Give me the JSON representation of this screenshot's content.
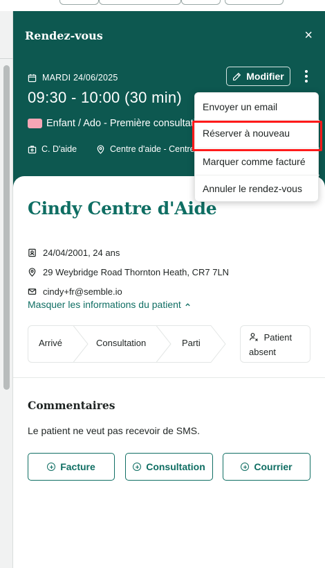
{
  "panel": {
    "title": "Rendez-vous",
    "close_label": "×"
  },
  "appointment": {
    "date": "MARDI 24/06/2025",
    "time": "09:30 - 10:00  (30 min)",
    "type": "Enfant / Ado - Première consultation",
    "type_color": "#f5a6b6",
    "practitioner": "C. D'aide",
    "location": "Centre d'aide - Centre"
  },
  "actions": {
    "edit_label": "Modifier",
    "more_icon": "kebab-icon"
  },
  "menu": {
    "items": [
      {
        "label": "Envoyer un email"
      },
      {
        "label": "Réserver à nouveau"
      },
      {
        "label": "Marquer comme facturé"
      },
      {
        "label": "Annuler le rendez-vous"
      }
    ]
  },
  "patient": {
    "name": "Cindy Centre d'Aide",
    "dob": "24/04/2001, 24 ans",
    "address": "29 Weybridge Road Thornton Heath, CR7 7LN",
    "email": "cindy+fr@semble.io",
    "toggle_label": "Masquer les informations du patient"
  },
  "status_steps": [
    {
      "label": "Arrivé"
    },
    {
      "label": "Consultation"
    },
    {
      "label": "Parti"
    }
  ],
  "absent": {
    "label_line1": "Patient",
    "label_line2": "absent"
  },
  "comments": {
    "title": "Commentaires",
    "text": "Le patient ne veut pas recevoir de SMS."
  },
  "bottom_buttons": [
    {
      "label": "Facture"
    },
    {
      "label": "Consultation"
    },
    {
      "label": "Courrier"
    }
  ],
  "colors": {
    "header_bg": "#0d5850",
    "accent": "#0f6e63",
    "highlight": "#ff1a1a"
  }
}
